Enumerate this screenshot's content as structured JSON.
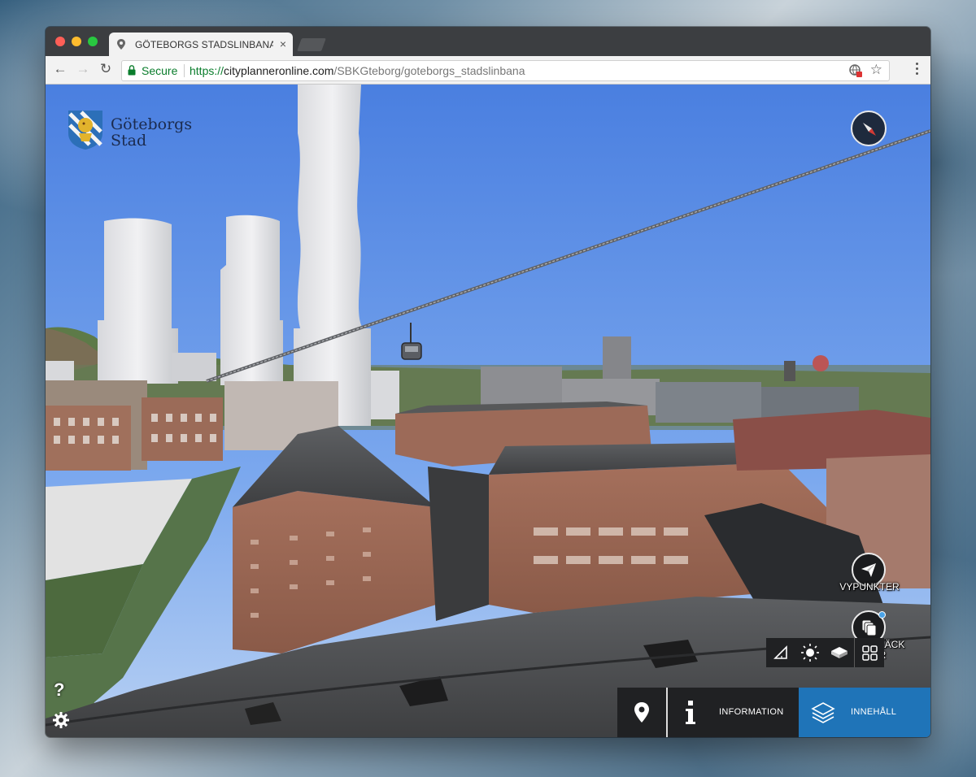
{
  "browser": {
    "tab_title": "GÖTEBORGS STADSLINBANA",
    "tab_close": "×",
    "back": "←",
    "forward": "→",
    "reload": "↻",
    "secure_label": "Secure",
    "url_scheme": "https://",
    "url_host": "cityplanneronline.com",
    "url_path": "/SBKGteborg/goteborgs_stadslinbana",
    "star": "☆"
  },
  "app": {
    "logo_line1": "Göteborgs",
    "logo_line2": "Stad",
    "help": "?",
    "vypunkter_label": "VYPUNKTER",
    "layers_label_line1": "TÄND & SLÄCK",
    "layers_label_line2": "LAGER",
    "bottom": {
      "information_label": "INFORMATION",
      "content_label": "INNEHÅLL"
    }
  },
  "colors": {
    "accent_blue": "#1f74b8",
    "secure_green": "#0a7d2c",
    "panel_dark": "#202123"
  },
  "icons": [
    "compass-icon",
    "paper-plane-icon",
    "layers-toggle-icon",
    "measure-icon",
    "sun-icon",
    "cube-icon",
    "grid-icon",
    "map-pin-icon",
    "info-icon",
    "layers-icon",
    "question-icon",
    "gear-icon"
  ]
}
